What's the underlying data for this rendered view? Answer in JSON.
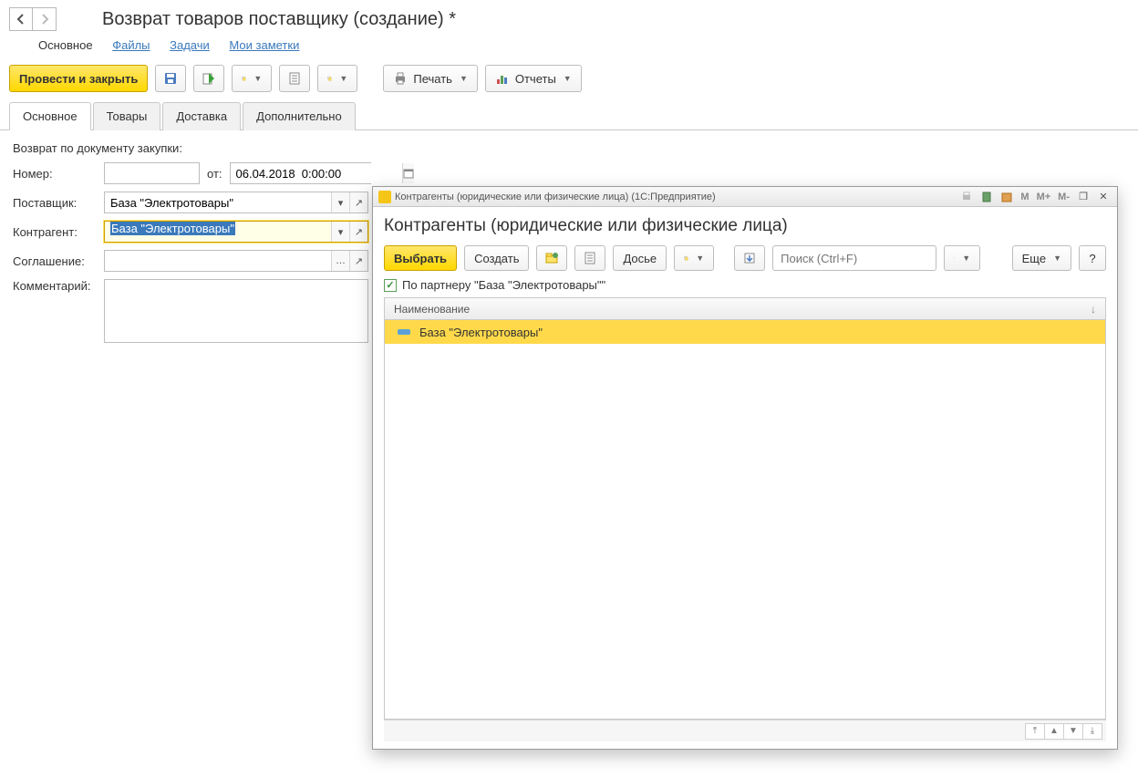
{
  "header": {
    "title": "Возврат товаров поставщику (создание) *"
  },
  "nav": {
    "main": "Основное",
    "files": "Файлы",
    "tasks": "Задачи",
    "notes": "Мои заметки"
  },
  "toolbar": {
    "post_and_close": "Провести и закрыть",
    "print": "Печать",
    "reports": "Отчеты"
  },
  "tabs": {
    "main": "Основное",
    "goods": "Товары",
    "delivery": "Доставка",
    "extra": "Дополнительно"
  },
  "form": {
    "purchase_doc_label": "Возврат по документу закупки:",
    "number_label": "Номер:",
    "number_value": "",
    "from_label": "от:",
    "date_value": "06.04.2018  0:00:00",
    "supplier_label": "Поставщик:",
    "supplier_value": "База \"Электротовары\"",
    "counterparty_label": "Контрагент:",
    "counterparty_value": "База \"Электротовары\"",
    "agreement_label": "Соглашение:",
    "agreement_value": "",
    "comment_label": "Комментарий:",
    "comment_value": ""
  },
  "dialog": {
    "window_title": "Контрагенты (юридические или физические лица)  (1С:Предприятие)",
    "heading": "Контрагенты (юридические или физические лица)",
    "select": "Выбрать",
    "create": "Создать",
    "dossier": "Досье",
    "search_placeholder": "Поиск (Ctrl+F)",
    "more": "Еще",
    "help": "?",
    "filter_label": "По партнеру \"База \"Электротовары\"\"",
    "column_name": "Наименование",
    "row0": "База \"Электротовары\"",
    "mem_m": "M",
    "mem_mplus": "M+",
    "mem_mminus": "M-"
  }
}
